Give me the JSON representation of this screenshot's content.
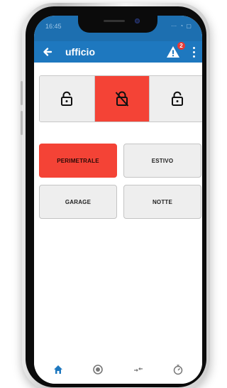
{
  "status_bar": {
    "time": "16:45",
    "icons": "⋯ ◔ ▢"
  },
  "app_bar": {
    "title": "ufficio",
    "back_icon": "arrow-back-icon",
    "alert_icon": "warning-icon",
    "alert_count": "2",
    "menu_icon": "more-vert-icon"
  },
  "lock_modes": [
    {
      "icon": "lock-open-icon",
      "active": false
    },
    {
      "icon": "lock-off-icon",
      "active": true
    },
    {
      "icon": "lock-open-icon",
      "active": false
    }
  ],
  "zones": [
    {
      "label": "PERIMETRALE",
      "active": true
    },
    {
      "label": "ESTIVO",
      "active": false
    },
    {
      "label": "GARAGE",
      "active": false
    },
    {
      "label": "NOTTE",
      "active": false
    }
  ],
  "bottom_nav": [
    {
      "icon": "home-icon",
      "active": true
    },
    {
      "icon": "record-icon",
      "active": false
    },
    {
      "icon": "transfer-icon",
      "active": false
    },
    {
      "icon": "timer-icon",
      "active": false
    }
  ],
  "colors": {
    "primary": "#1e78bf",
    "status_bar": "#1d6fb0",
    "active": "#f44336",
    "inactive_button": "#eeeeee",
    "badge": "#e53935"
  }
}
